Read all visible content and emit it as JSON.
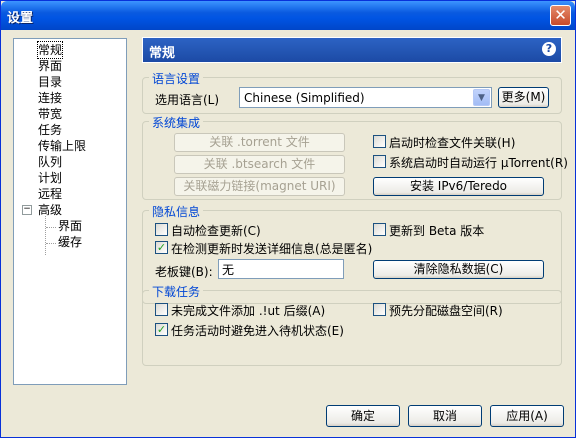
{
  "window": {
    "title": "设置",
    "close_glyph": "✕"
  },
  "tree": {
    "items": [
      "常规",
      "界面",
      "目录",
      "连接",
      "带宽",
      "任务",
      "传输上限",
      "队列",
      "计划",
      "远程",
      "高级",
      "界面",
      "缓存"
    ],
    "expander": "−"
  },
  "header": {
    "title": "常规",
    "help_glyph": "?"
  },
  "language": {
    "group_label": "语言设置",
    "label": "选用语言(L)",
    "value": "Chinese (Simplified)",
    "more_button": "更多(M)"
  },
  "integration": {
    "group_label": "系统集成",
    "assoc_torrent": "关联 .torrent 文件",
    "assoc_btsearch": "关联 .btsearch 文件",
    "assoc_magnet": "关联磁力链接(magnet URI)",
    "check_assoc_label": "启动时检查文件关联(H)",
    "check_assoc_checked": false,
    "autorun_label": "系统启动时自动运行 μTorrent(R)",
    "autorun_checked": false,
    "ipv6_button": "安装 IPv6/Teredo"
  },
  "privacy": {
    "group_label": "隐私信息",
    "auto_update_label": "自动检查更新(C)",
    "auto_update_checked": false,
    "beta_label": "更新到 Beta 版本",
    "beta_checked": false,
    "send_info_label": "在检测更新时发送详细信息(总是匿名)",
    "send_info_checked": true,
    "boss_key_label": "老板键(B):",
    "boss_key_value": "无",
    "clear_button": "清除隐私数据(C)"
  },
  "tasks": {
    "group_label": "下载任务",
    "append_ut_label": "未完成文件添加 .!ut 后缀(A)",
    "append_ut_checked": false,
    "prealloc_label": "预先分配磁盘空间(R)",
    "prealloc_checked": false,
    "standby_label": "任务活动时避免进入待机状态(E)",
    "standby_checked": true
  },
  "footer": {
    "ok": "确定",
    "cancel": "取消",
    "apply": "应用(A)"
  },
  "check_glyph": "✓"
}
